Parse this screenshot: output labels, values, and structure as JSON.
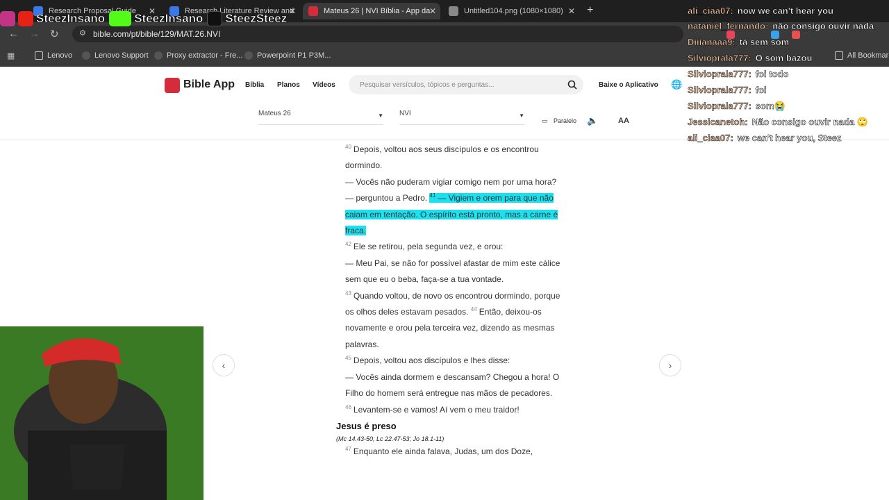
{
  "browser": {
    "tabs": [
      {
        "title": "Research Proposal Guide",
        "active": false,
        "color": "#3b78e7"
      },
      {
        "title": "Research Literature Review and",
        "active": false,
        "color": "#3b78e7"
      },
      {
        "title": "Mateus 26 | NVI Bíblia - App da",
        "active": true,
        "color": "#d62b3a"
      },
      {
        "title": "Untitled104.png (1080×1080)",
        "active": false,
        "color": "#888888"
      }
    ],
    "url": "bible.com/pt/bible/129/MAT.26.NVI",
    "bookmarks": [
      "Lenovo",
      "Lenovo Support",
      "Proxy extractor - Fre...",
      "Powerpoint P1 P3M..."
    ],
    "all_bookmarks": "All Bookmarks"
  },
  "stream": {
    "handles": [
      "SteezInsano",
      "SteezInsano",
      "SteezSteez"
    ]
  },
  "site": {
    "logo": "Bible App",
    "nav": [
      "Bíblia",
      "Planos",
      "Vídeos"
    ],
    "search_placeholder": "Pesquisar versículos, tópicos e perguntas...",
    "download": "Baixe o Aplicativo",
    "book_select": "Mateus 26",
    "version_select": "NVI",
    "parallel": "Paralelo",
    "font_size": "AA"
  },
  "reader": {
    "v40_num": "40",
    "v40_text": "Depois, voltou aos seus discípulos e os encontrou dormindo.",
    "q1": "— Vocês não puderam vigiar comigo nem por uma hora? — perguntou a Pedro.",
    "v41_num": "41",
    "v41_text": "— Vigiem e orem para que não caiam em tentação. O espírito está pronto, mas a carne é fraca.",
    "v42_num": "42",
    "v42_text": "Ele se retirou, pela segunda vez, e orou:",
    "q2": "— Meu Pai, se não for possível afastar de mim este cálice sem que eu o beba, faça-se a tua vontade.",
    "v43_num": "43",
    "v43_text": "Quando voltou, de novo os encontrou dormindo, porque os olhos deles estavam pesados.",
    "v44_num": "44",
    "v44_text": "Então, deixou-os novamente e orou pela terceira vez, dizendo as mesmas palavras.",
    "v45_num": "45",
    "v45_text": "Depois, voltou aos discípulos e lhes disse:",
    "q3": "— Vocês ainda dormem e descansam? Chegou a hora! O Filho do homem será entregue nas mãos de pecadores.",
    "v46_num": "46",
    "v46_text": "Levantem-se e vamos! Aí vem o meu traidor!",
    "heading": "Jesus é preso",
    "xref": "(Mc 14.43-50; Lc 22.47-53; Jo 18.1-11)",
    "v47_num": "47",
    "v47_text": "Enquanto ele ainda falava, Judas, um dos Doze,"
  },
  "chat": [
    {
      "user": "ali_ciaa07:",
      "msg": "now we can't hear you"
    },
    {
      "user": "nataniel_fernando:",
      "msg": "não consigo ouvir nada"
    },
    {
      "user": "Diiianaaa9:",
      "msg": "tá sem som"
    },
    {
      "user": "Silvioprala777:",
      "msg": "O som bazou"
    },
    {
      "user": "Silvioprala777:",
      "msg": "foi todo"
    },
    {
      "user": "Silvioprala777:",
      "msg": "foi"
    },
    {
      "user": "Silvioprala777:",
      "msg": "som😭"
    },
    {
      "user": "Jessicanetoh:",
      "msg": "Não consigo ouvir nada 🙄"
    },
    {
      "user": "ali_ciaa07:",
      "msg": "we can't hear you, Steez"
    }
  ]
}
